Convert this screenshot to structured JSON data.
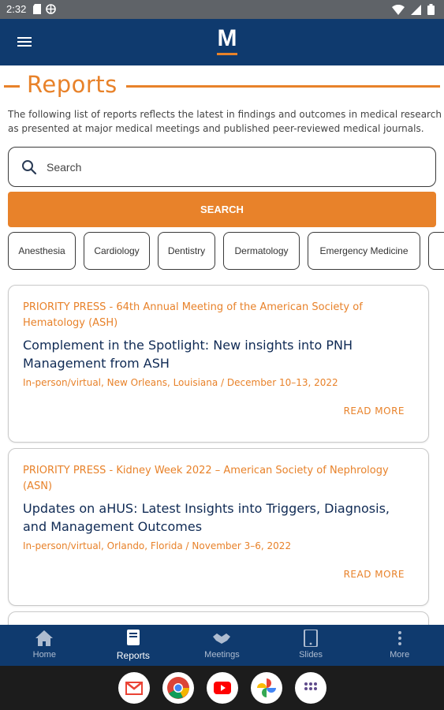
{
  "status_bar": {
    "time": "2:32"
  },
  "app": {
    "logo_letter": "M"
  },
  "header": {
    "title": "Reports"
  },
  "intro_lines": [
    "The following list of reports reflects the latest in findings and outcomes in medical research",
    "as presented at major medical meetings and published peer-reviewed medical journals."
  ],
  "search": {
    "placeholder": "Search",
    "button_label": "SEARCH"
  },
  "chips": [
    "Anesthesia",
    "Cardiology",
    "Dentistry",
    "Dermatology",
    "Emergency Medicine",
    ""
  ],
  "cards": [
    {
      "source": "PRIORITY PRESS - 64th Annual Meeting of the American Society of Hematology (ASH)",
      "headline": "Complement in the Spotlight: New insights into PNH Management from ASH",
      "meta": "In-person/virtual, New Orleans, Louisiana / December 10–13, 2022",
      "read_more": "READ MORE"
    },
    {
      "source": "PRIORITY PRESS - Kidney Week 2022 – American Society of Nephrology (ASN)",
      "headline": "Updates on aHUS: Latest Insights into Triggers, Diagnosis, and Management Outcomes",
      "meta": "In-person/virtual, Orlando, Florida / November 3–6, 2022",
      "read_more": "READ MORE"
    }
  ],
  "bottom_nav": [
    {
      "label": "Home",
      "icon": "home-icon",
      "active": false
    },
    {
      "label": "Reports",
      "icon": "book-icon",
      "active": true
    },
    {
      "label": "Meetings",
      "icon": "handshake-icon",
      "active": false
    },
    {
      "label": "Slides",
      "icon": "tablet-icon",
      "active": false
    },
    {
      "label": "More",
      "icon": "more-vert-icon",
      "active": false
    }
  ],
  "dock_apps": [
    "gmail-icon",
    "chrome-icon",
    "youtube-icon",
    "photos-icon",
    "app-drawer-icon"
  ],
  "colors": {
    "brand_navy": "#0f3a6e",
    "accent_orange": "#e8822a",
    "headline_navy": "#0f2a54"
  }
}
